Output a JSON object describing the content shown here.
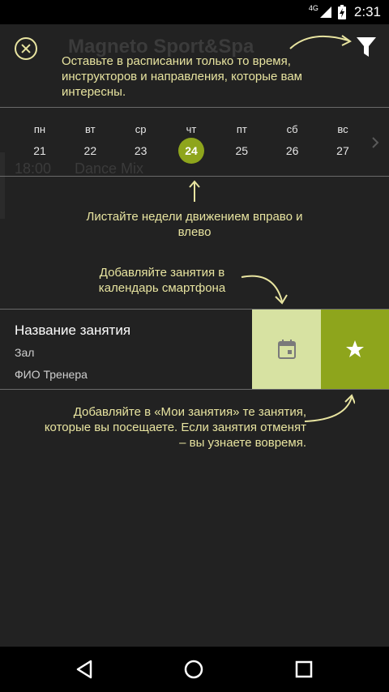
{
  "status_bar": {
    "network": "4G",
    "time": "2:31"
  },
  "background": {
    "title": "Magneto Sport&Spa",
    "time": "18:00",
    "class_name": "Dance Mix"
  },
  "hints": {
    "filter": "Оставьте в расписании только то время, инструкторов и направления, которые вам интересны.",
    "swipe": "Листайте недели движением вправо и влево",
    "calendar": "Добавляйте занятия в календарь смартфона",
    "favorites": "Добавляйте в «Мои занятия» те занятия, которые вы посещаете. Если занятия отменят – вы узнаете вовремя."
  },
  "week": {
    "day_names": [
      "пн",
      "вт",
      "ср",
      "чт",
      "пт",
      "сб",
      "вс"
    ],
    "day_numbers": [
      "21",
      "22",
      "23",
      "24",
      "25",
      "26",
      "27"
    ],
    "selected_index": 3
  },
  "class_card": {
    "title": "Название занятия",
    "room": "Зал",
    "trainer": "ФИО Тренера"
  },
  "icons": {
    "close": "close-icon",
    "filter": "filter-icon",
    "calendar": "calendar-icon",
    "star": "star-icon"
  },
  "colors": {
    "accent": "#8ea51c",
    "accent_light": "#d7e2a2",
    "hint_text": "#e8e4a0",
    "background": "#222222"
  }
}
